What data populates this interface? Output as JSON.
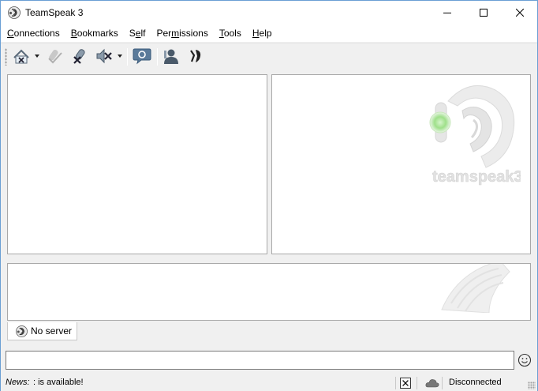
{
  "window": {
    "title": "TeamSpeak 3"
  },
  "menu": {
    "items": [
      {
        "label": "Connections",
        "accel": "C",
        "rest": "onnections"
      },
      {
        "label": "Bookmarks",
        "accel": "B",
        "rest": "ookmarks"
      },
      {
        "label": "Self",
        "accel": "S",
        "rest": "elf",
        "pre": ""
      },
      {
        "label": "Permissions",
        "accel": "",
        "rest": ""
      },
      {
        "label": "Tools",
        "accel": "T",
        "rest": "ools"
      },
      {
        "label": "Help",
        "accel": "H",
        "rest": "elp"
      }
    ]
  },
  "toolbar": {
    "icons": [
      "disconnect-icon",
      "away-icon",
      "mute-microphone-icon",
      "mute-speakers-icon",
      "subscribe-channels-icon",
      "contacts-icon",
      "whisper-icon"
    ]
  },
  "logo": {
    "wordmark": "teamspeak3"
  },
  "tab": {
    "label": "No server"
  },
  "input": {
    "value": ""
  },
  "statusbar": {
    "news_label": "News:",
    "news_text": ": is available!",
    "connection_status": "Disconnected"
  },
  "colors": {
    "accent_green": "#7fd36b",
    "window_border": "#6a9fd4"
  }
}
